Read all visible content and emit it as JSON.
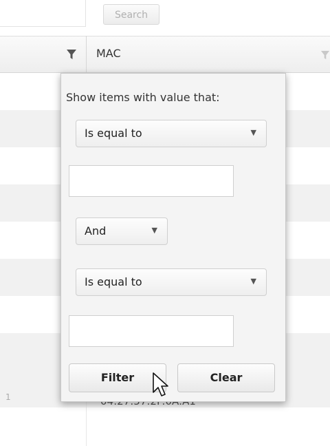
{
  "toolbar": {
    "search_label": "Search"
  },
  "grid": {
    "columns": [
      {
        "label": "MAC"
      }
    ],
    "visible_row_text": "04:27:57:2F:0A:A1",
    "edge_text": "1"
  },
  "filter_popup": {
    "title": "Show items with value that:",
    "operator1": "Is equal to",
    "value1": "",
    "logic": "And",
    "operator2": "Is equal to",
    "value2": "",
    "filter_label": "Filter",
    "clear_label": "Clear"
  },
  "icons": {
    "column_filter": "filter-icon",
    "dropdown_arrow": "chevron-down-icon",
    "cursor": "mouse-pointer-icon"
  }
}
